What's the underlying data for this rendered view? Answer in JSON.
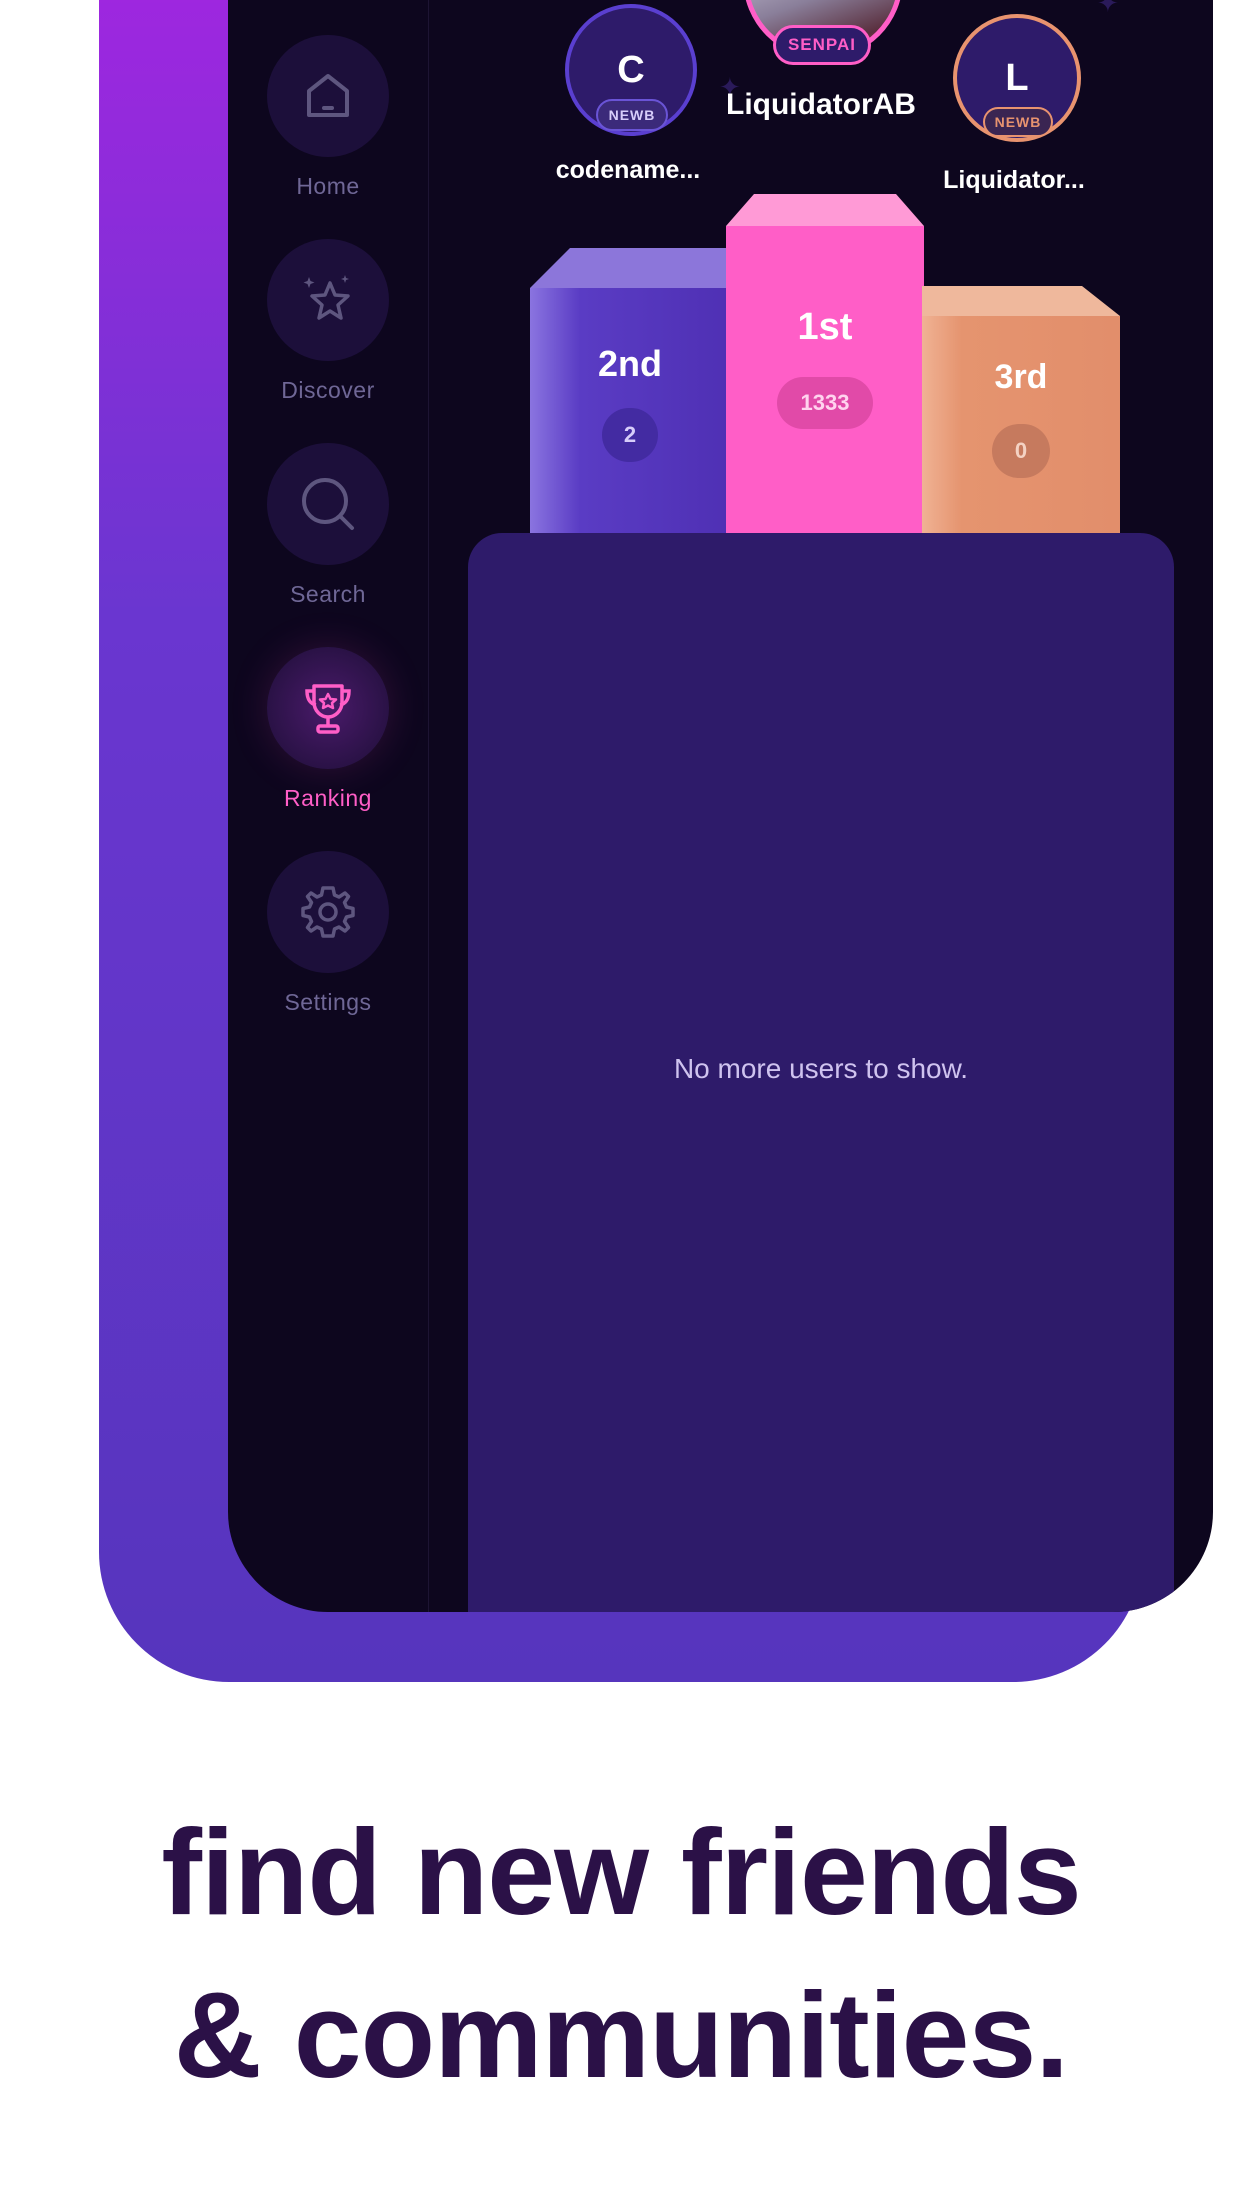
{
  "nav": {
    "home_label": "Home",
    "discover_label": "Discover",
    "search_label": "Search",
    "ranking_label": "Ranking",
    "settings_label": "Settings",
    "active": "Ranking"
  },
  "podium": {
    "first": {
      "name": "LiquidatorAB",
      "badge": "SENPAI",
      "place": "1st",
      "score": "1333"
    },
    "second": {
      "name": "codename...",
      "initial": "C",
      "badge": "NEWB",
      "place": "2nd",
      "score": "2"
    },
    "third": {
      "name": "Liquidator...",
      "initial": "L",
      "badge": "NEWB",
      "place": "3rd",
      "score": "0"
    }
  },
  "list": {
    "empty_message": "No more users to show."
  },
  "tagline": {
    "line1": "find new friends",
    "line2": "& communities."
  },
  "colors": {
    "accent_pink": "#ff5ec7",
    "second_purple": "#5533b8",
    "third_orange": "#e8936f",
    "panel": "#2e1b6a",
    "tagline": "#2b1147"
  }
}
